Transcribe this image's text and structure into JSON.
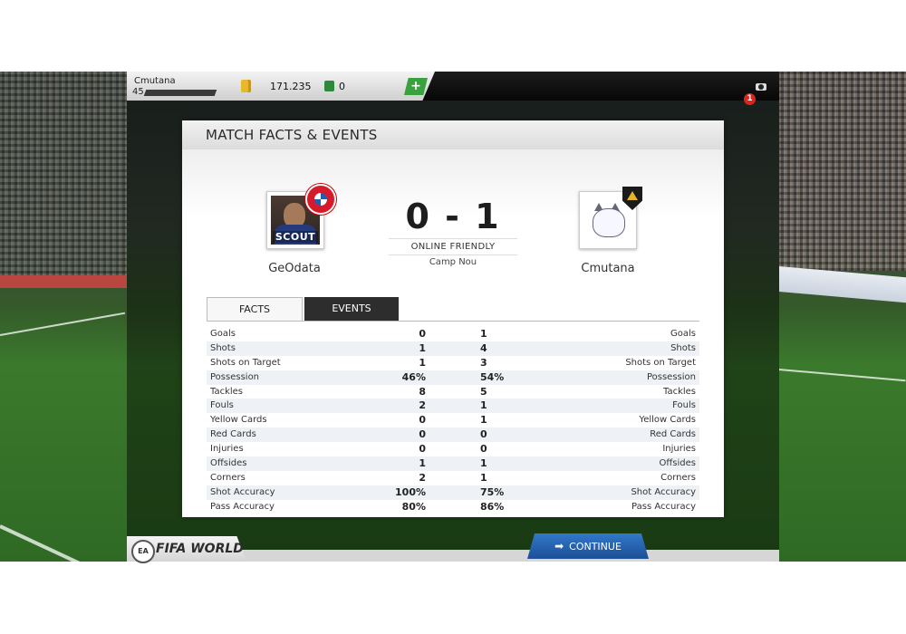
{
  "topbar": {
    "user_name": "Cmutana",
    "level": "45",
    "coins": "171.235",
    "points": "0",
    "add_label": "+",
    "notification_count": "1"
  },
  "panel": {
    "title": "MATCH FACTS & EVENTS"
  },
  "match": {
    "home_team": "GeOdata",
    "home_badge_text": "SCOUT",
    "away_team": "Cmutana",
    "score": "0 - 1",
    "type": "ONLINE FRIENDLY",
    "venue": "Camp Nou"
  },
  "tabs": {
    "facts": "FACTS",
    "events": "EVENTS"
  },
  "stats": [
    {
      "label": "Goals",
      "home": "0",
      "away": "1"
    },
    {
      "label": "Shots",
      "home": "1",
      "away": "4"
    },
    {
      "label": "Shots on Target",
      "home": "1",
      "away": "3"
    },
    {
      "label": "Possession",
      "home": "46%",
      "away": "54%"
    },
    {
      "label": "Tackles",
      "home": "8",
      "away": "5"
    },
    {
      "label": "Fouls",
      "home": "2",
      "away": "1"
    },
    {
      "label": "Yellow Cards",
      "home": "0",
      "away": "1"
    },
    {
      "label": "Red Cards",
      "home": "0",
      "away": "0"
    },
    {
      "label": "Injuries",
      "home": "0",
      "away": "0"
    },
    {
      "label": "Offsides",
      "home": "1",
      "away": "1"
    },
    {
      "label": "Corners",
      "home": "2",
      "away": "1"
    },
    {
      "label": "Shot Accuracy",
      "home": "100%",
      "away": "75%"
    },
    {
      "label": "Pass Accuracy",
      "home": "80%",
      "away": "86%"
    }
  ],
  "footer": {
    "ea_label": "EA",
    "brand": "FIFA WORLD",
    "continue_label": "CONTINUE",
    "continue_icon": "arrow-right-icon"
  },
  "colors": {
    "continue_blue": "#2a66b5",
    "add_green": "#3aa13f",
    "notif_red": "#d7261e"
  }
}
